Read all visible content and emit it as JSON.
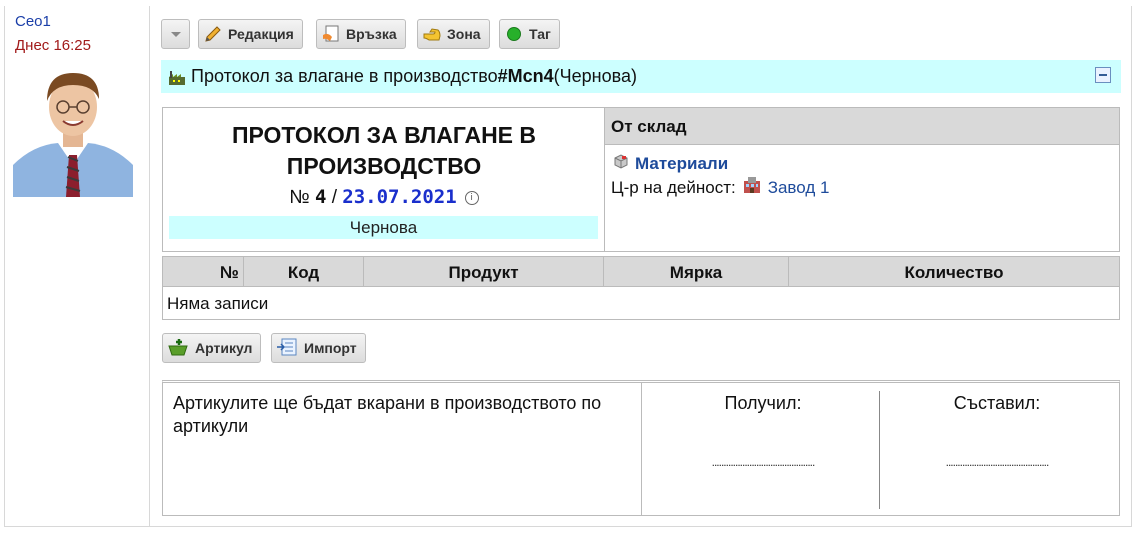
{
  "author": {
    "name": "Ceo1",
    "timestamp": "Днес 16:25"
  },
  "toolbar": {
    "edit": "Редакция",
    "link": "Връзка",
    "zone": "Зона",
    "tag": "Таг"
  },
  "header": {
    "title": "Протокол за влагане в производство ",
    "doc_id": "#Mcn4",
    "state": " (Чернова)"
  },
  "document": {
    "title": "ПРОТОКОЛ ЗА ВЛАГАНЕ В ПРОИЗВОДСТВО",
    "number_prefix": "№ ",
    "number": "4",
    "separator": " / ",
    "date": "23.07.2021",
    "state": "Чернова"
  },
  "warehouse": {
    "heading": "От склад",
    "name": "Материали",
    "activity_label": "Ц-р на дейност:",
    "activity_value": "Завод 1"
  },
  "table": {
    "columns": [
      "№",
      "Код",
      "Продукт",
      "Мярка",
      "Количество"
    ],
    "empty": "Няма записи"
  },
  "actions": {
    "article": "Артикул",
    "import": "Импорт"
  },
  "signatures": {
    "note": "Артикулите ще бъдат вкарани в производството по артикули",
    "received": "Получил:",
    "composed": "Съставил:",
    "dots": "............................................"
  },
  "colors": {
    "accent": "#ccffff",
    "link": "#1e4b9b",
    "date": "#1a2fcc"
  }
}
